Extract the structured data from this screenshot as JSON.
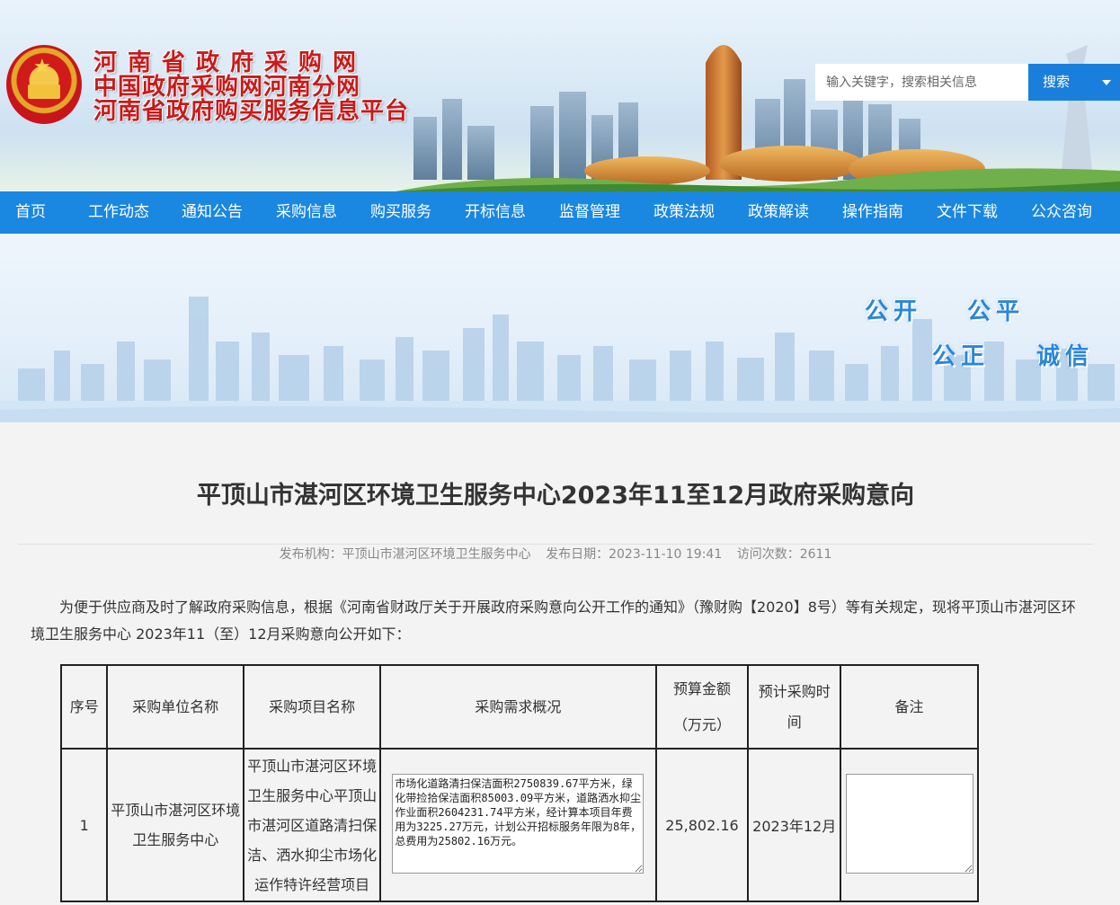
{
  "header": {
    "title_line1": "河南省政府采购网",
    "title_line2": "中国政府采购网河南分网",
    "title_line3": "河南省政府购买服务信息平台",
    "search_placeholder": "输入关键字，搜索相关信息",
    "search_button": "搜索"
  },
  "nav": {
    "items": [
      "首页",
      "工作动态",
      "通知公告",
      "采购信息",
      "购买服务",
      "开标信息",
      "监督管理",
      "政策法规",
      "政策解读",
      "操作指南",
      "文件下载",
      "公众咨询"
    ]
  },
  "banner": {
    "slogan": [
      "公开",
      "公平",
      "公正",
      "诚信"
    ]
  },
  "article": {
    "title": "平顶山市湛河区环境卫生服务中心2023年11至12月政府采购意向",
    "meta": {
      "publisher": "发布机构：平顶山市湛河区环境卫生服务中心",
      "date": "发布日期：2023-11-10 19:41",
      "visits": "访问次数：2611"
    },
    "intro": "为便于供应商及时了解政府采购信息，根据《河南省财政厅关于开展政府采购意向公开工作的通知》（豫财购【2020】8号）等有关规定，现将平顶山市湛河区环境卫生服务中心 2023年11（至）12月采购意向公开如下："
  },
  "table": {
    "headers": {
      "no": "序号",
      "unit": "采购单位名称",
      "project": "采购项目名称",
      "requirement": "采购需求概况",
      "budget_line1": "预算金额",
      "budget_line2": "（万元）",
      "time": "预计采购时间",
      "remark": "备注"
    },
    "rows": [
      {
        "no": "1",
        "unit": "平顶山市湛河区环境卫生服务中心",
        "project": "平顶山市湛河区环境卫生服务中心平顶山市湛河区道路清扫保洁、洒水抑尘市场化运作特许经营项目",
        "requirement": "市场化道路清扫保洁面积2750839.67平方米，绿化带捡拾保洁面积85003.09平方米，道路洒水抑尘作业面积2604231.74平方米，经计算本项目年费用为3225.27万元，计划公开招标服务年限为8年，总费用为25802.16万元。",
        "budget": "25,802.16",
        "time": "2023年12月",
        "remark": ""
      }
    ]
  },
  "colors": {
    "nav_bg": "#1a87e0",
    "search_button": "#1a7fdc",
    "title_red": "#c81a1a",
    "slogan_blue": "#2a86d8"
  }
}
